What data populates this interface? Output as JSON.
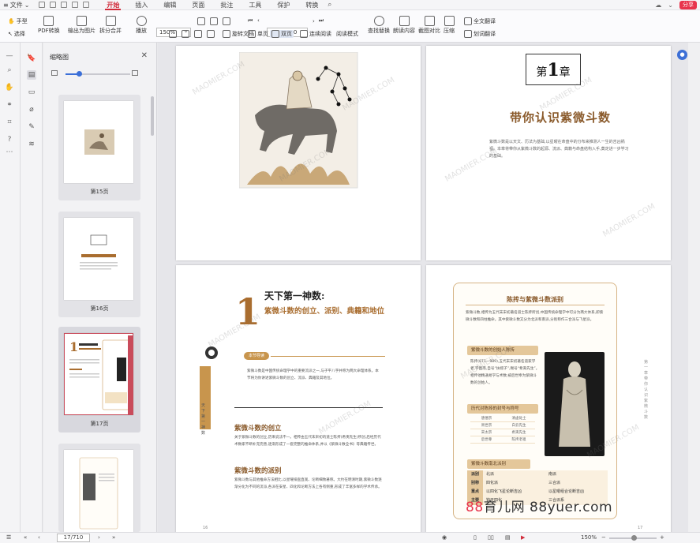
{
  "menubar": {
    "file_label": "文件",
    "tabs": [
      "开始",
      "插入",
      "编辑",
      "页面",
      "批注",
      "工具",
      "保护",
      "转换"
    ],
    "active_tab": "开始",
    "share_label": "分享"
  },
  "ribbon": {
    "hand_label": "手型",
    "select_label": "选择",
    "pdf_convert_label": "PDF转换",
    "output_image_label": "输出为图片",
    "split_merge_label": "拆分合并",
    "play_label": "播放",
    "zoom_value": "150%",
    "page_value": "17/710",
    "rotate_doc_label": "旋转文档",
    "single_label": "单页",
    "double_label": "双页",
    "continuous_label": "连续阅读",
    "read_mode_label": "阅读模式",
    "find_replace_label": "查找替换",
    "read_aloud_label": "朗读内容",
    "screenshot_compare_label": "截图对比",
    "compress_label": "压缩",
    "full_translate_label": "全文翻译",
    "word_translate_label": "划词翻译"
  },
  "thumbnails": {
    "title": "缩略图",
    "items": [
      {
        "caption": "第15页"
      },
      {
        "caption": "第16页"
      },
      {
        "caption": "第17页"
      },
      {
        "caption": "第18页"
      }
    ]
  },
  "page_chapter": {
    "chapter_prefix": "第",
    "chapter_num": "1",
    "chapter_suffix": "章",
    "title": "带你认识紫微斗数",
    "intro": "紫微斗数是以天文、历法为基础,以星曜在命盘中的分布来推测人一生的吉凶祸福。本章将带你从紫微斗数的起源、流派、典籍与命盘结构入手,奠定进一步学习的基础。"
  },
  "page_left": {
    "num": "1",
    "heading": "天下第一神数:",
    "subheading": "紫微斗数的创立、派别、典籍和地位",
    "tag": "本节导读",
    "intro_text": "紫微斗数是中国传统命理学中的重要流派之一,与子平八字并称为两大命理体系。本节将为你讲述紫微斗数的创立、流派、典籍及其地位。",
    "side_text": "天下第一神数",
    "section1": "紫微斗数的创立",
    "section1_text": "关于紫微斗数的创立,历来说法不一。相传由五代末宋初的道士陈抟(希夷先生)所创,后经历代术数家不断补充完善,逐渐形成了一套完整的推命体系,并以《紫微斗数全书》等典籍传世。",
    "section2": "紫微斗数的派别",
    "section2_text": "紫微斗数与其他推命方法相比,以星曜排盘直观、论断细致著称。大约在明清时期,紫微斗数逐渐分化为不同的流派,各派在安星、四化和论断方法上各有侧重,形成了丰富多样的学术传承。",
    "page_number": "16"
  },
  "page_right": {
    "frame_title": "陈抟与紫微斗数派别",
    "frame_intro": "紫微斗数,相传为五代末宋初著名道士陈抟所创,中国传统命理学中可分为两大体系,即紫微斗数和四柱推命。其中紫微斗数又分为北派和南派,分别称作三合派与飞星派。",
    "box1_title": "紫微斗数的创始人陈抟",
    "box1_text": "陈抟(871—989),五代末宋初著名道家学者,字图南,自号“扶摇子”,赐号“希夷先生”。相传他精通易学与术数,被后世奉为紫微斗数的创始人。",
    "box2_title": "历代对陈抟的封号与称号",
    "table": [
      [
        "唐僖宗",
        "清虚处士"
      ],
      [
        "周世宗",
        "白云先生"
      ],
      [
        "宋太宗",
        "希夷先生"
      ],
      [
        "后世尊",
        "陈抟老祖"
      ]
    ],
    "box3_title": "紫微斗数南北派别",
    "ns_table": [
      {
        "k": "派别",
        "a": "北派",
        "b": "南派"
      },
      {
        "k": "别称",
        "a": "四化派",
        "b": "三合派"
      },
      {
        "k": "重点",
        "a": "以四化飞星论断吉凶",
        "b": "以星曜组合论断吉凶"
      },
      {
        "k": "主要",
        "a": "钦天四化",
        "b": "三合派系"
      }
    ],
    "side_text": "第一章 带你认识紫微斗数",
    "page_number": "17"
  },
  "watermark_text": "MAOMIER.COM",
  "status": {
    "page_value": "17/710",
    "zoom_value": "150%",
    "brand_left": "88",
    "brand_mid": "育儿网",
    "brand_url": "88yuer.com"
  }
}
